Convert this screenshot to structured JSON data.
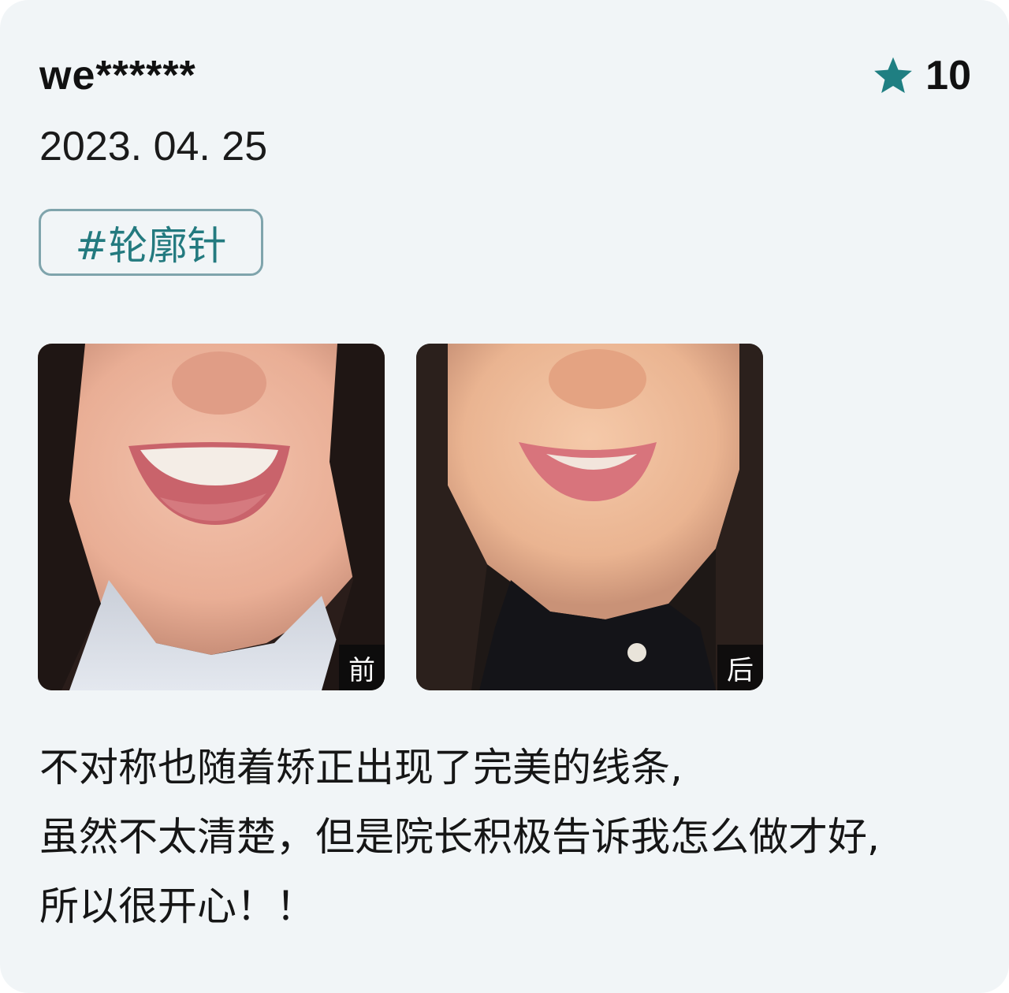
{
  "review": {
    "username": "we******",
    "rating": "10",
    "rating_icon": "star-icon",
    "accent_color": "#1f7f82",
    "date": "2023. 04. 25",
    "tag": "#轮廓针",
    "photos": [
      {
        "label": "前"
      },
      {
        "label": "后"
      }
    ],
    "text_lines": [
      "不对称也随着矫正出现了完美的线条,",
      "虽然不太清楚，但是院长积极告诉我怎么做才好,",
      "所以很开心！！"
    ]
  }
}
